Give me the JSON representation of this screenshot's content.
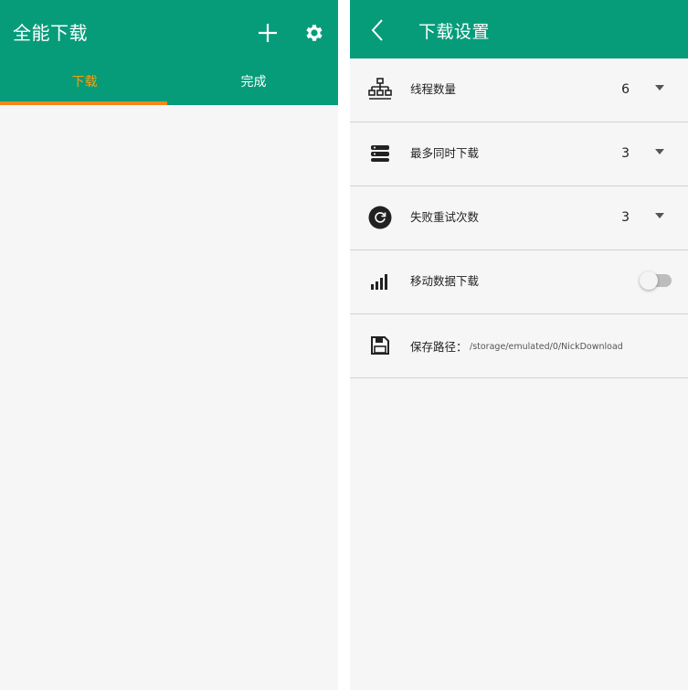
{
  "left_screen": {
    "title": "全能下载",
    "icons": [
      "plus-icon",
      "gear-icon"
    ],
    "tabs": [
      {
        "label": "下载",
        "active": true
      },
      {
        "label": "完成",
        "active": false
      }
    ]
  },
  "right_screen": {
    "title": "下载设置",
    "icons": [
      "back-arrow-icon"
    ],
    "settings": [
      {
        "label": "线程数量",
        "value": "6",
        "icon": "network-icon"
      },
      {
        "label": "最多同时下载",
        "value": "3",
        "icon": "server-stack-icon"
      },
      {
        "label": "失败重试次数",
        "value": "3",
        "icon": "retry-icon"
      },
      {
        "label": "移动数据下载",
        "enabled": false,
        "icon": "signal-bars-icon"
      },
      {
        "label": "保存路径：",
        "value": "/storage/emulated/0/NickDownload",
        "icon": "save-disk-icon"
      }
    ]
  },
  "colors": {
    "primary": "#069c7a",
    "tab_active": "#f2a013",
    "tab_indicator": "#ee8a1a",
    "background": "#f6f6f6"
  }
}
